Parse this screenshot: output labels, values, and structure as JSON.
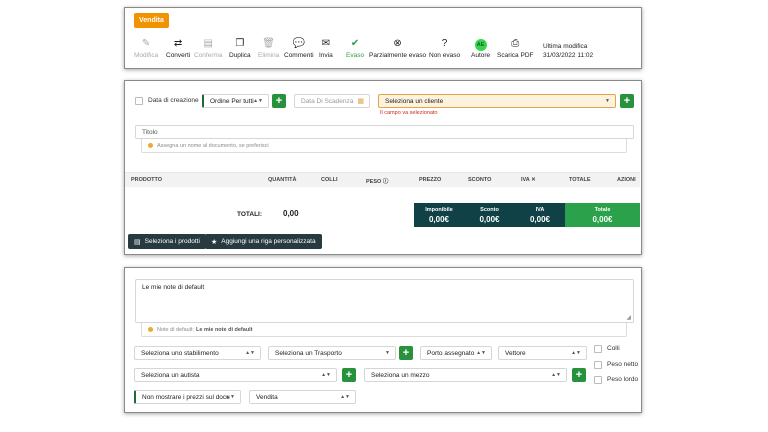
{
  "header": {
    "badge": "Vendita",
    "toolbar": [
      {
        "label": "Modifica",
        "icon": "edit-icon",
        "glyph": "✎",
        "state": "disabled"
      },
      {
        "label": "Converti",
        "icon": "convert-icon",
        "glyph": "⇄",
        "state": "normal"
      },
      {
        "label": "Conferma",
        "icon": "clipboard-icon",
        "glyph": "▤",
        "state": "disabled"
      },
      {
        "label": "Duplica",
        "icon": "duplicate-icon",
        "glyph": "❐",
        "state": "normal"
      },
      {
        "label": "Elimina",
        "icon": "trash-icon",
        "glyph": "🗑",
        "state": "disabled"
      },
      {
        "label": "Commenti",
        "icon": "comments-icon",
        "glyph": "💬",
        "state": "normal"
      },
      {
        "label": "Invia",
        "icon": "envelope-icon",
        "glyph": "✉",
        "state": "normal"
      },
      {
        "label": "Evaso",
        "icon": "check-circle-icon",
        "glyph": "✔",
        "state": "active"
      },
      {
        "label": "Parzialmente evaso",
        "icon": "x-circle-icon",
        "glyph": "⊗",
        "state": "normal"
      },
      {
        "label": "Non evaso",
        "icon": "question-circle-icon",
        "glyph": "?",
        "state": "normal"
      },
      {
        "label": "Autore",
        "icon": "author-avatar-icon",
        "glyph": "AE",
        "state": "normal"
      },
      {
        "label": "Scarica PDF",
        "icon": "pdf-icon",
        "glyph": "⎙",
        "state": "normal"
      }
    ],
    "last_modified_label": "Ultima modifica",
    "last_modified_value": "31/03/2022 11:02"
  },
  "document": {
    "date_checkbox_label": "Data di creazione",
    "order_select": "Ordine Per tutti",
    "due_date_placeholder": "Data Di Scadenza",
    "client_select": "Seleziona un cliente",
    "client_error": "Il campo va selezionato",
    "title_placeholder": "Titolo",
    "title_hint": "Assegna un nome al documento, se preferisci",
    "columns": [
      "PRODOTTO",
      "QUANTITÀ",
      "COLLI",
      "PESO",
      "PREZZO",
      "SCONTO",
      "IVA",
      "TOTALE",
      "AZIONI"
    ],
    "totals_label": "TOTALI:",
    "totals_value": "0,00",
    "summary": [
      {
        "label": "Imponibile",
        "value": "0,00€"
      },
      {
        "label": "Sconto",
        "value": "0,00€"
      },
      {
        "label": "IVA",
        "value": "0,00€"
      },
      {
        "label": "Totale",
        "value": "0,00€"
      }
    ],
    "select_products_button": "Seleziona i prodotti",
    "add_custom_row_button": "Aggiungi una riga personalizzata"
  },
  "footer": {
    "notes_text": "Le mie note di default",
    "notes_hint_prefix": "Note di default:",
    "notes_hint_value": "Le mie note di default",
    "establishment_select": "Seleziona uno stabilimento",
    "transport_select": "Seleziona un Trasporto",
    "port_select": "Porto assegnato",
    "carrier_select": "Vettore",
    "driver_select": "Seleziona un autista",
    "vehicle_select": "Seleziona un mezzo",
    "prices_select": "Non mostrare i prezzi sul docu",
    "type_select": "Vendita",
    "checkboxes": [
      "Colli",
      "Peso netto",
      "Peso lordo"
    ]
  }
}
